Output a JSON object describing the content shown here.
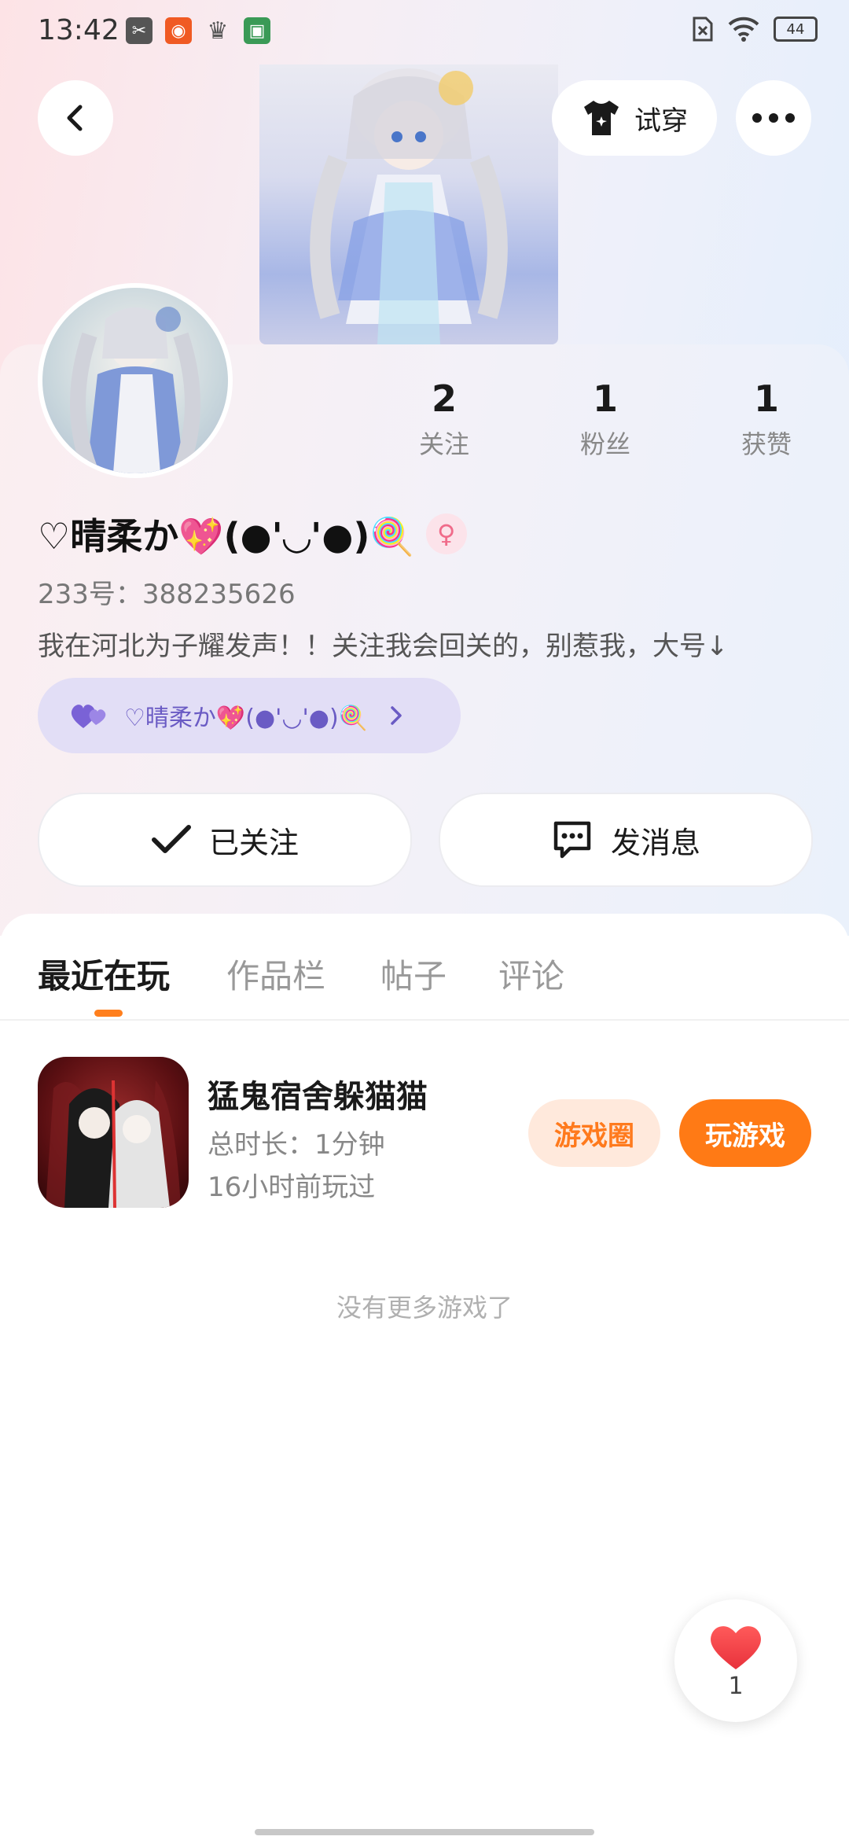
{
  "status_bar": {
    "time": "13:42",
    "battery": "44",
    "icons": [
      "scissors-icon",
      "store-icon",
      "crown-icon",
      "game-thumb-icon",
      "sim-off-icon",
      "wifi-icon",
      "battery-icon"
    ]
  },
  "header": {
    "tryon_label": "试穿"
  },
  "stats": [
    {
      "value": "2",
      "label": "关注"
    },
    {
      "value": "1",
      "label": "粉丝"
    },
    {
      "value": "1",
      "label": "获赞"
    }
  ],
  "profile": {
    "nickname": "♡晴柔か💖(●'◡'●)🍭",
    "gender_symbol": "♀",
    "account_id": "233号：388235626",
    "bio": "我在河北为子耀发声！！关注我会回关的，别惹我，大号↓",
    "linked_account": "♡晴柔か💖(●'◡'●)🍭"
  },
  "actions": {
    "followed_label": "已关注",
    "message_label": "发消息"
  },
  "tabs": [
    {
      "label": "最近在玩",
      "active": true
    },
    {
      "label": "作品栏",
      "active": false
    },
    {
      "label": "帖子",
      "active": false
    },
    {
      "label": "评论",
      "active": false
    }
  ],
  "games": [
    {
      "title": "猛鬼宿舍躲猫猫",
      "duration": "总时长：1分钟",
      "last_played": "16小时前玩过",
      "circle_label": "游戏圈",
      "play_label": "玩游戏"
    }
  ],
  "empty_text": "没有更多游戏了",
  "like_fab": {
    "count": "1"
  },
  "colors": {
    "accent": "#ff7a15",
    "accent_soft": "#ffe9dc",
    "linked_pill": "#e2def6",
    "linked_text": "#6a5bc4",
    "like_red": "#f0454a"
  }
}
